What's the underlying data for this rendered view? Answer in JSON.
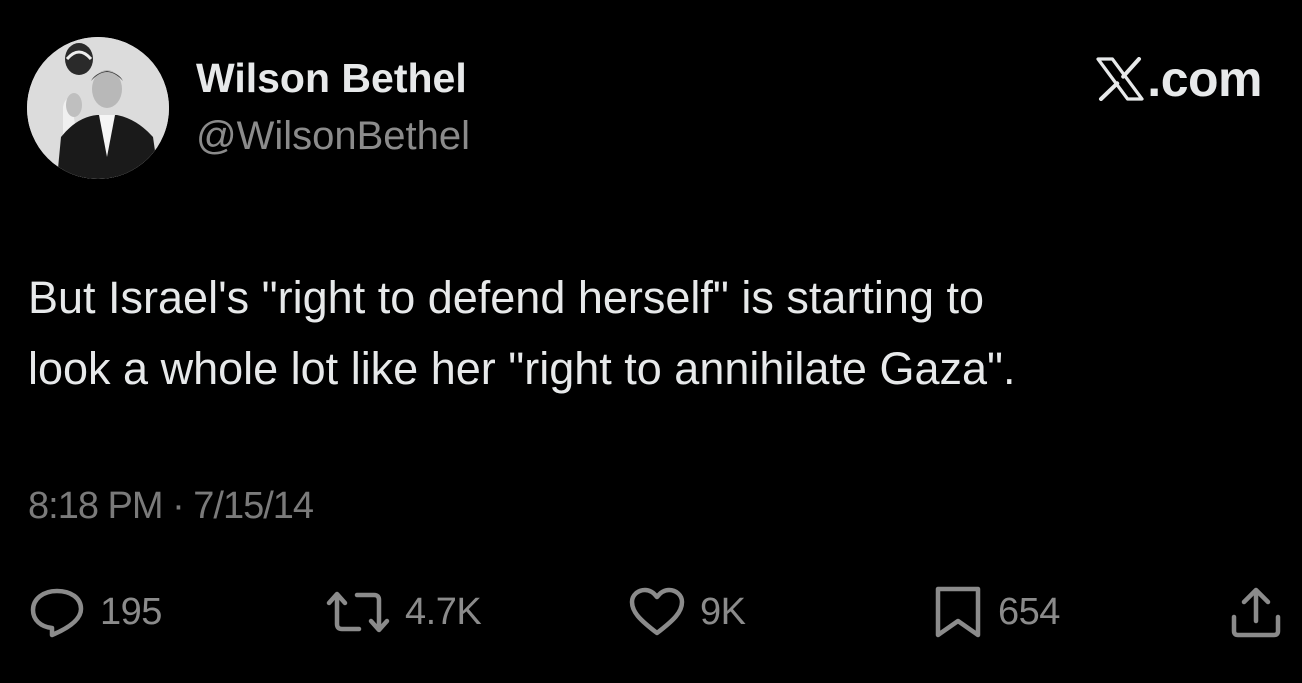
{
  "author": {
    "name": "Wilson Bethel",
    "handle": "@WilsonBethel",
    "avatar_icon": "profile-photo"
  },
  "brand": {
    "logo_icon": "x-logo-icon",
    "domain": ".com"
  },
  "tweet": {
    "text_lines": [
      "But Israel's \"right to defend herself\" is starting to",
      "look a whole lot like her \"right to annihilate Gaza\"."
    ],
    "timestamp": "8:18 PM · 7/15/14"
  },
  "actions": {
    "reply": {
      "icon": "reply-icon",
      "count": "195"
    },
    "repost": {
      "icon": "repost-icon",
      "count": "4.7K"
    },
    "like": {
      "icon": "heart-icon",
      "count": "9K"
    },
    "bookmark": {
      "icon": "bookmark-icon",
      "count": "654"
    },
    "share": {
      "icon": "share-icon"
    }
  },
  "colors": {
    "background": "#000000",
    "primary_text": "#e7e9ea",
    "secondary_text": "#8b8b8b"
  }
}
